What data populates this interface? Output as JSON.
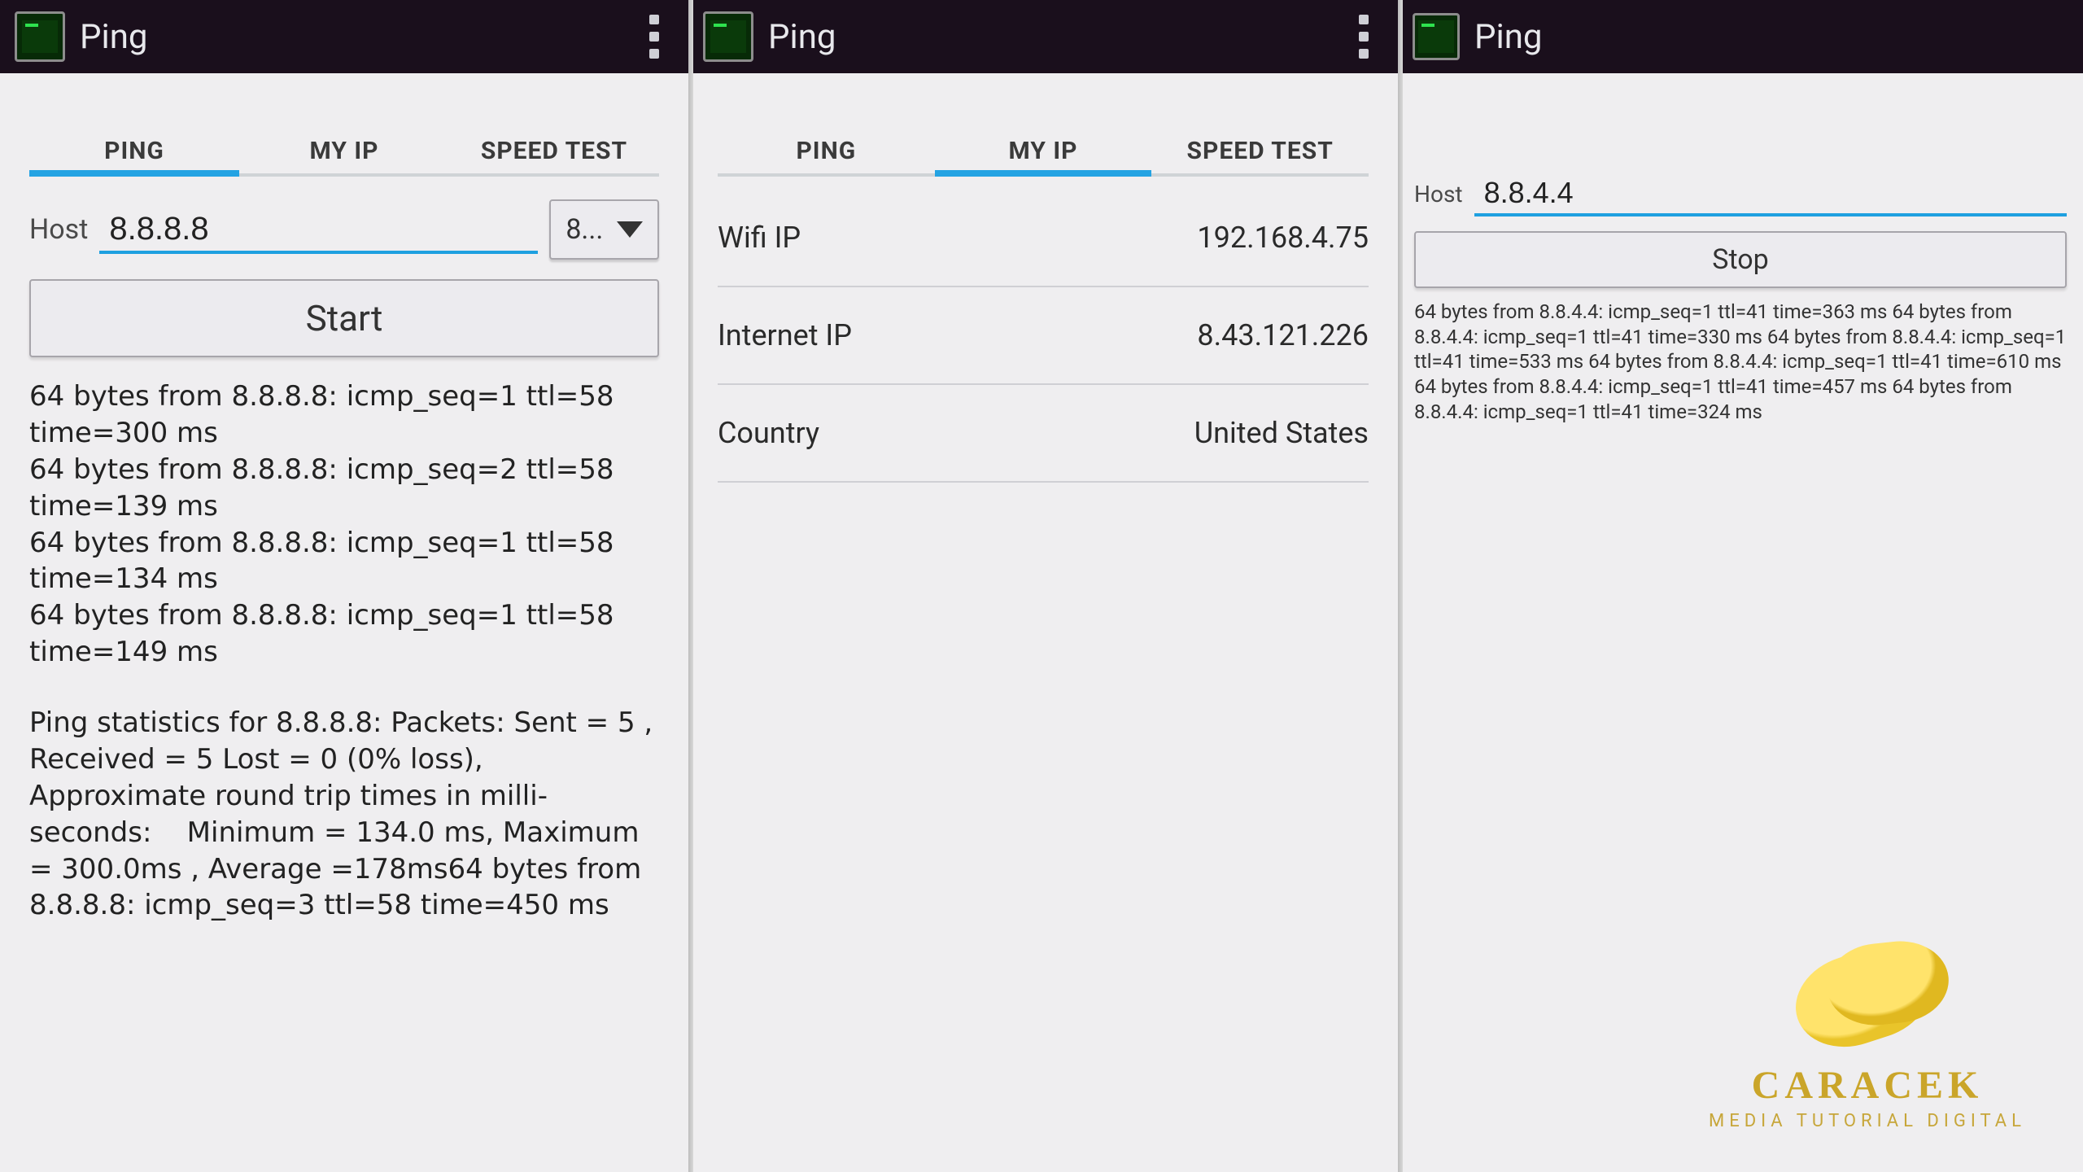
{
  "app_title": "Ping",
  "tabs": {
    "ping": "PING",
    "myip": "MY IP",
    "speed": "SPEED TEST"
  },
  "left": {
    "host_label": "Host",
    "host_value": "8.8.8.8",
    "select_text": "8...",
    "start_btn": "Start",
    "lines": [
      "64 bytes from 8.8.8.8: icmp_seq=1 ttl=58 time=300 ms",
      "64 bytes from 8.8.8.8: icmp_seq=2 ttl=58 time=139 ms",
      "64 bytes from 8.8.8.8: icmp_seq=1 ttl=58 time=134 ms",
      "64 bytes from 8.8.8.8: icmp_seq=1 ttl=58 time=149 ms"
    ],
    "stats": "Ping statistics for 8.8.8.8: Packets: Sent = 5 , Received = 5 Lost = 0 (0% loss),  Approximate round trip times in milli-seconds:    Minimum = 134.0 ms, Maximum = 300.0ms , Average =178ms64 bytes from 8.8.8.8: icmp_seq=3 ttl=58 time=450 ms"
  },
  "mid": {
    "rows": [
      {
        "label": "Wifi IP",
        "value": "192.168.4.75"
      },
      {
        "label": "Internet IP",
        "value": "8.43.121.226"
      },
      {
        "label": "Country",
        "value": "United States"
      }
    ]
  },
  "right": {
    "host_label": "Host",
    "host_value": "8.8.4.4",
    "stop_btn": "Stop",
    "lines": [
      "64 bytes from 8.8.4.4: icmp_seq=1 ttl=41 time=363 ms",
      "64 bytes from 8.8.4.4: icmp_seq=1 ttl=41 time=330 ms",
      "64 bytes from 8.8.4.4: icmp_seq=1 ttl=41 time=533 ms",
      "64 bytes from 8.8.4.4: icmp_seq=1 ttl=41 time=610 ms",
      "64 bytes from 8.8.4.4: icmp_seq=1 ttl=41 time=457 ms",
      "64 bytes from 8.8.4.4: icmp_seq=1 ttl=41 time=324 ms"
    ]
  },
  "watermark": {
    "brand": "CARACEK",
    "tagline": "MEDIA TUTORIAL DIGITAL"
  }
}
